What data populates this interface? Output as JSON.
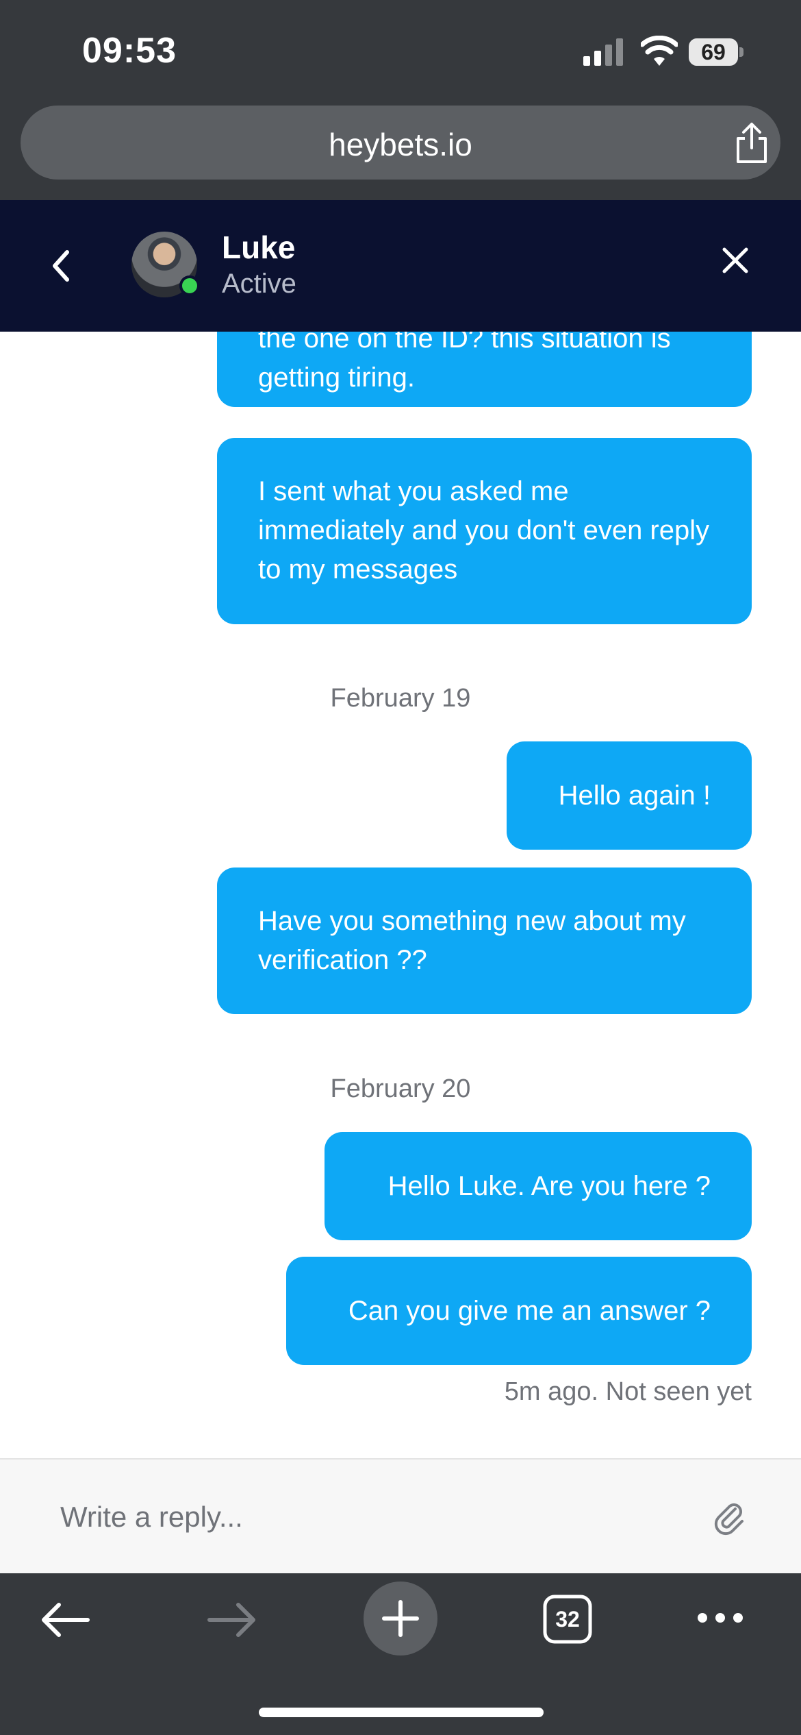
{
  "status": {
    "time": "09:53",
    "battery": "69"
  },
  "browser": {
    "url": "heybets.io",
    "tab_count": "32"
  },
  "chat": {
    "name": "Luke",
    "presence": "Active"
  },
  "messages": {
    "m1_line1": "the one on the ID? this situation is",
    "m1_line2": "getting tiring.",
    "m2": "I sent what you asked me immediately and you don't even reply to my messages",
    "date1": "February 19",
    "m3": "Hello again !",
    "m4": "Have you something new about my verification ??",
    "date2": "February 20",
    "m5": "Hello Luke. Are you here ?",
    "m6": "Can you give me an answer ?",
    "seen_status": "5m ago. Not seen yet"
  },
  "reply": {
    "placeholder": "Write a reply..."
  },
  "icons": {
    "share": "share-icon",
    "back": "chevron-left-icon",
    "close": "close-icon",
    "attach": "paperclip-icon",
    "nav_back": "arrow-left-icon",
    "nav_forward": "arrow-right-icon",
    "new_tab": "plus-icon",
    "tabs": "tabs-icon",
    "more": "more-icon"
  },
  "colors": {
    "bubble": "#0ea8f5",
    "header": "#0b1130",
    "chrome": "#36393d",
    "online": "#39d353"
  }
}
